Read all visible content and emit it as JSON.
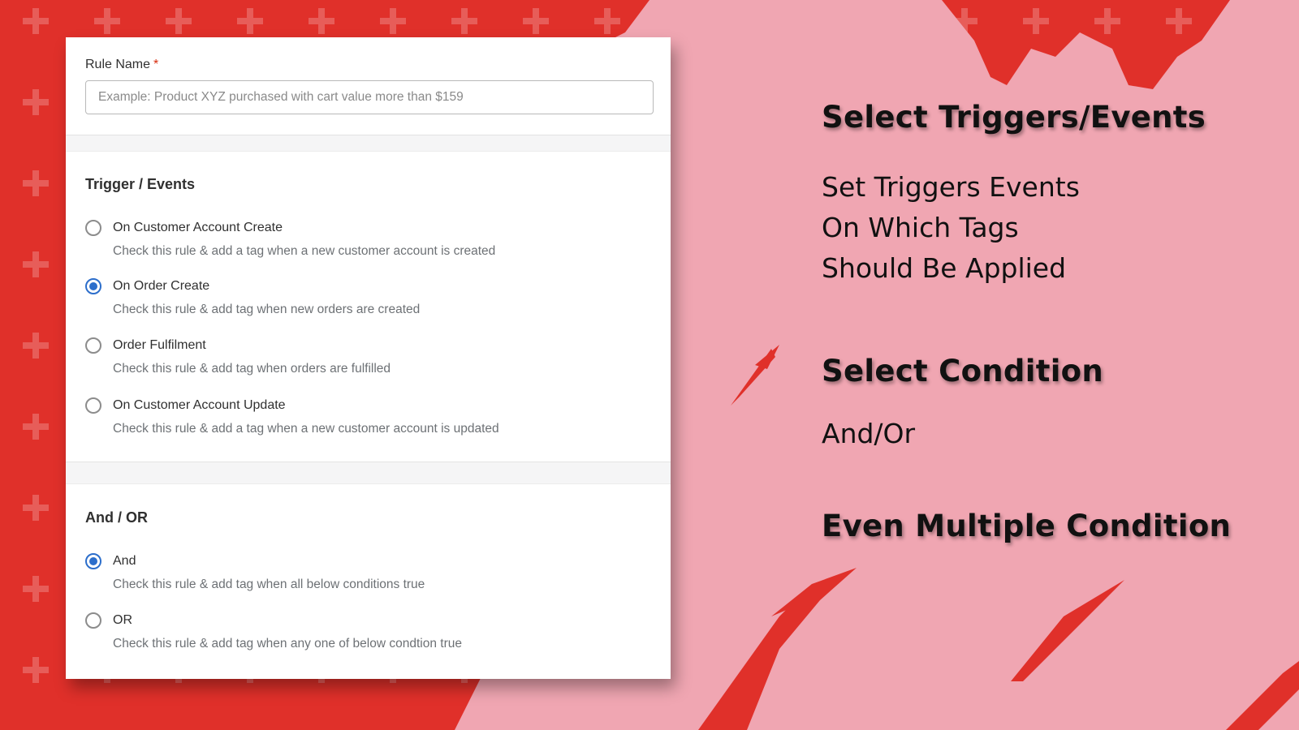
{
  "colors": {
    "background_red": "#e0302a",
    "background_pink": "#f0a6b2",
    "accent_blue": "#2c6ecb",
    "required_red": "#d72c0d"
  },
  "form": {
    "rule_name_label": "Rule Name",
    "required_marker": "*",
    "rule_name_placeholder": "Example: Product XYZ purchased with cart value more than $159",
    "rule_name_value": "",
    "trigger_section": {
      "title": "Trigger / Events",
      "options": [
        {
          "label": "On Customer Account Create",
          "help": "Check this rule & add a tag when a new customer account is created",
          "checked": false
        },
        {
          "label": "On Order Create",
          "help": "Check this rule & add tag when new orders are created",
          "checked": true
        },
        {
          "label": "Order Fulfilment",
          "help": "Check this rule & add tag when orders are fulfilled",
          "checked": false
        },
        {
          "label": "On Customer Account Update",
          "help": "Check this rule & add a tag when a new customer account is updated",
          "checked": false
        }
      ]
    },
    "andor_section": {
      "title": "And / OR",
      "options": [
        {
          "label": "And",
          "help": "Check this rule & add tag when all below conditions true",
          "checked": true
        },
        {
          "label": "OR",
          "help": "Check this rule & add tag when any one of below condtion true",
          "checked": false
        }
      ]
    }
  },
  "promo": {
    "heading1": "Select Triggers/Events",
    "body1": [
      "Set Triggers Events",
      "On Which Tags",
      "Should Be Applied"
    ],
    "heading2": "Select Condition",
    "body2": "And/Or",
    "heading3": "Even Multiple Condition"
  }
}
